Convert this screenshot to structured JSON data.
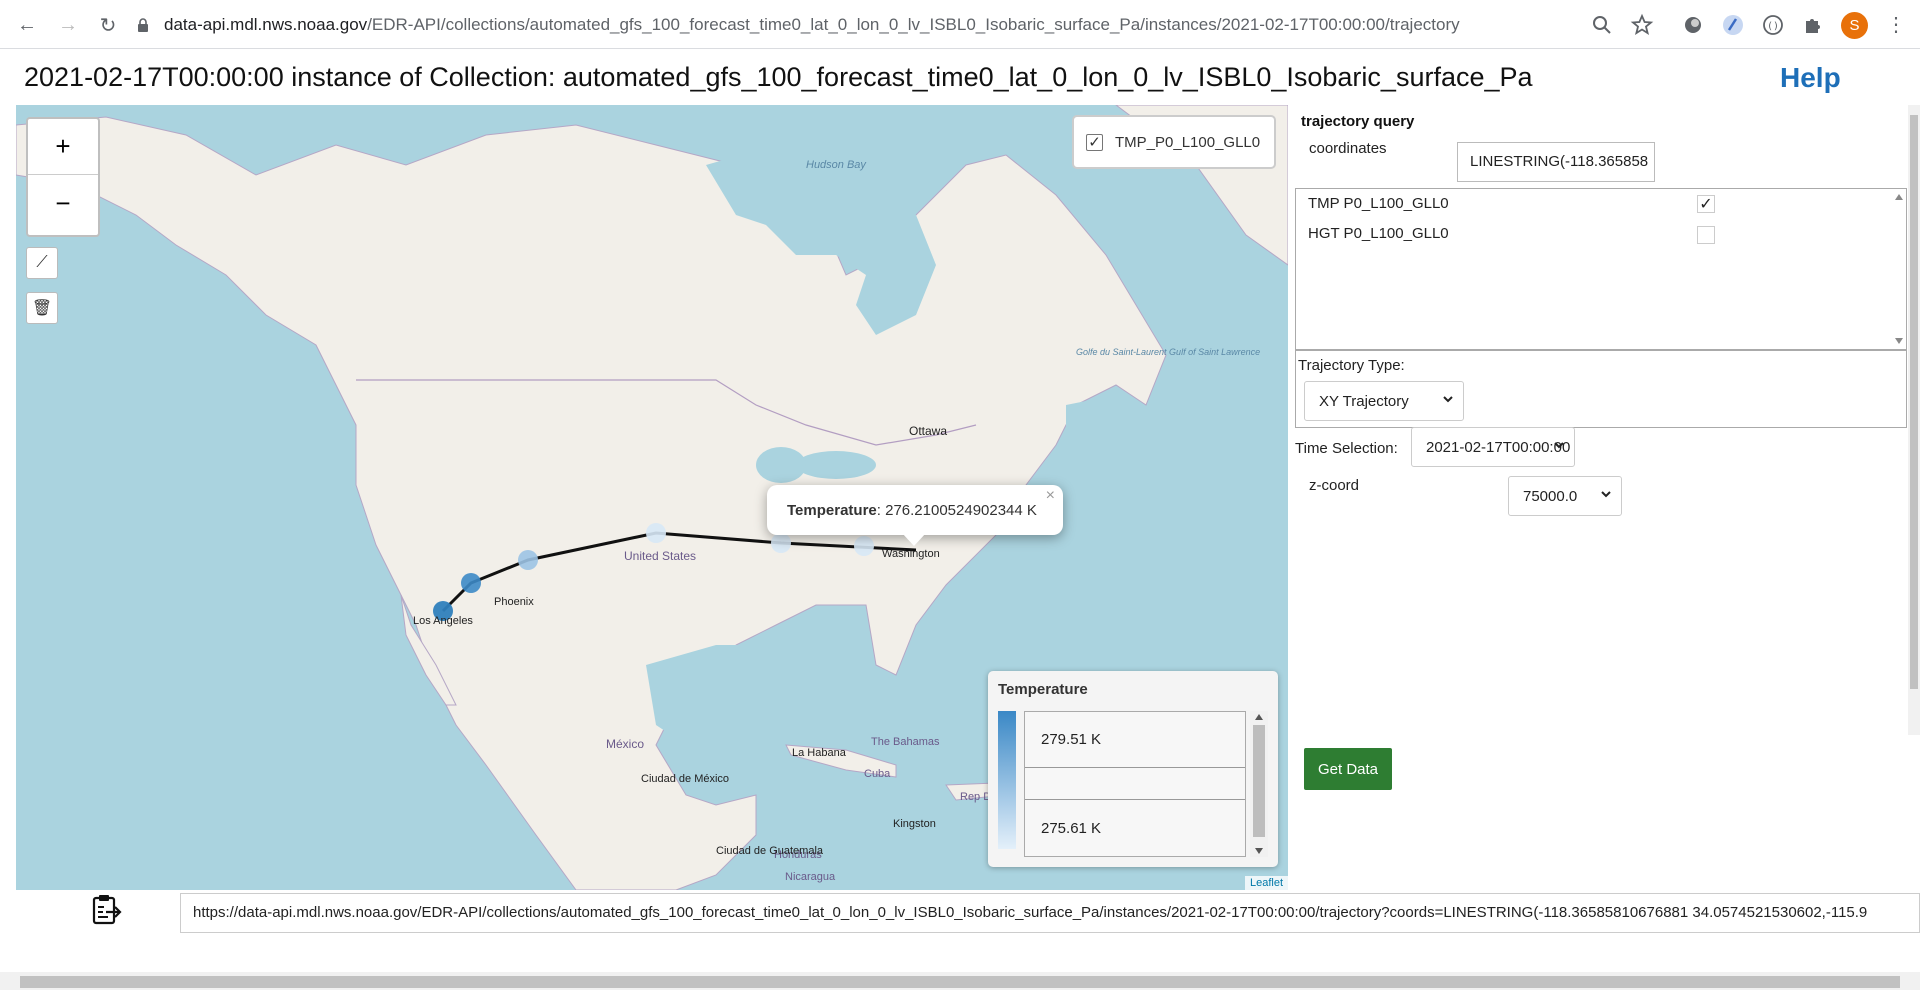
{
  "browser": {
    "url_host": "data-api.mdl.nws.noaa.gov",
    "url_path": "/EDR-API/collections/automated_gfs_100_forecast_time0_lat_0_lon_0_lv_ISBL0_Isobaric_surface_Pa/instances/2021-02-17T00:00:00/trajectory",
    "profile_initial": "S"
  },
  "header": {
    "title": "2021-02-17T00:00:00 instance of Collection: automated_gfs_100_forecast_time0_lat_0_lon_0_lv_ISBL0_Isobaric_surface_Pa",
    "help_label": "Help"
  },
  "map": {
    "zoom_in": "+",
    "zoom_out": "−",
    "layer_label": "TMP_P0_L100_GLL0",
    "labels": {
      "hudson_bay": "Hudson Bay",
      "ottawa": "Ottawa",
      "united_states": "United States",
      "washington": "Washington",
      "phoenix": "Phoenix",
      "los_angeles": "Los Angeles",
      "mexico": "México",
      "ciudad_mexico": "Ciudad de México",
      "la_habana": "La Habana",
      "bahamas": "The Bahamas",
      "cuba": "Cuba",
      "kingston": "Kingston",
      "honduras": "Honduras",
      "ciudad_guatemala": "Ciudad de Guatemala",
      "nicaragua": "Nicaragua",
      "golfe": "Golfe du Saint-Laurent Gulf of Saint Lawrence",
      "rep_dom": "Rep Domi"
    },
    "popup": {
      "label": "Temperature",
      "value": ": 276.2100524902344 K",
      "close": "×"
    },
    "legend": {
      "title": "Temperature",
      "items": [
        "279.51 K",
        "",
        "275.61 K"
      ]
    },
    "attribution": "Leaflet"
  },
  "side": {
    "title": "trajectory query",
    "coords_label": "coordinates",
    "coords_value": "LINESTRING(-118.365858",
    "parameters": [
      {
        "label": "TMP P0_L100_GLL0",
        "checked": true
      },
      {
        "label": "HGT P0_L100_GLL0",
        "checked": false
      }
    ],
    "traj_type_label": "Trajectory Type:",
    "traj_type_value": "XY Trajectory",
    "time_label": "Time Selection:",
    "time_value": "2021-02-17T00:00:00",
    "z_label": "z-coord",
    "z_value": "75000.0",
    "get_data": "Get Data"
  },
  "footer": {
    "request_url": "https://data-api.mdl.nws.noaa.gov/EDR-API/collections/automated_gfs_100_forecast_time0_lat_0_lon_0_lv_ISBL0_Isobaric_surface_Pa/instances/2021-02-17T00:00:00/trajectory?coords=LINESTRING(-118.36585810676881 34.0574521530602,-115.9"
  }
}
